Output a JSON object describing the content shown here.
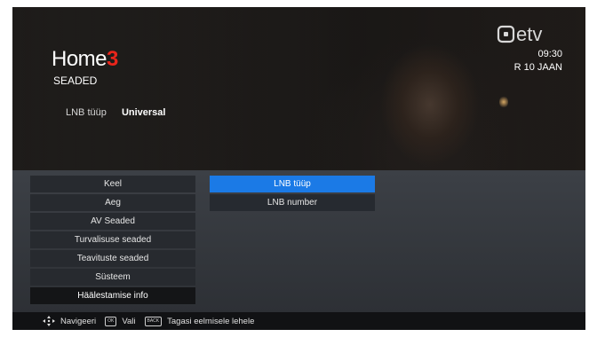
{
  "brand": {
    "home_text": "Home",
    "home_number": "3",
    "number_color": "#e8251b",
    "channel": "etv"
  },
  "clock": {
    "time": "09:30",
    "date": "R 10 JAAN"
  },
  "section_title": "SEADED",
  "info": {
    "label": "LNB tüüp",
    "value": "Universal"
  },
  "menu": {
    "items": [
      {
        "label": "Keel"
      },
      {
        "label": "Aeg"
      },
      {
        "label": "AV Seaded"
      },
      {
        "label": "Turvalisuse seaded"
      },
      {
        "label": "Teavituste seaded"
      },
      {
        "label": "Süsteem"
      },
      {
        "label": "Häälestamise info",
        "active": true
      }
    ]
  },
  "submenu": {
    "items": [
      {
        "label": "LNB tüüp",
        "selected": true
      },
      {
        "label": "LNB number"
      }
    ],
    "highlight_color": "#1b7ae6"
  },
  "footer": {
    "navigate_label": "Navigeeri",
    "ok_key": "OK",
    "ok_label": "Vali",
    "back_key": "BACK",
    "back_label": "Tagasi eelmisele lehele"
  }
}
